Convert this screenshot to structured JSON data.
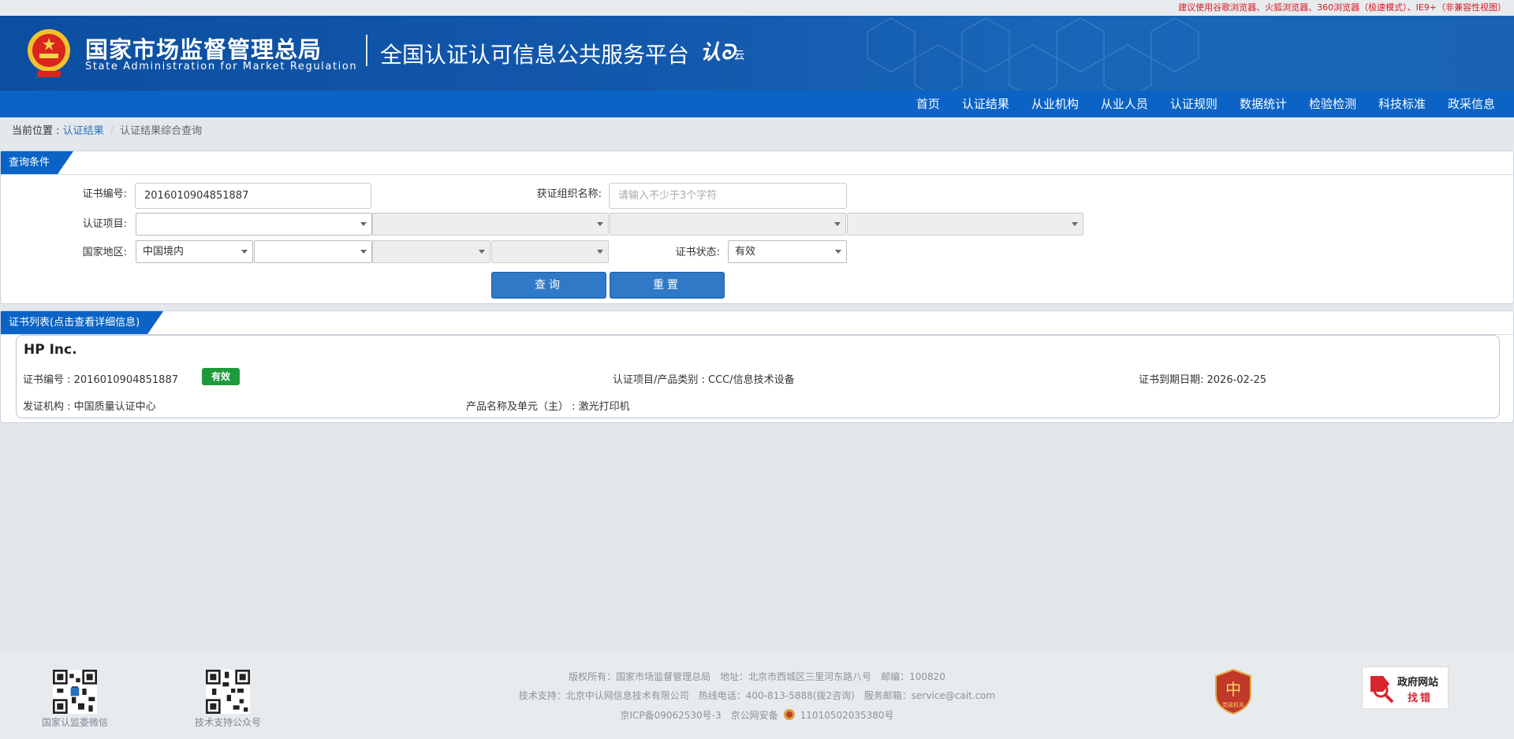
{
  "notice": "建议使用谷歌浏览器、火狐浏览器、360浏览器（极速模式）、IE9+（非兼容性视图）",
  "header": {
    "brand_cn": "国家市场监督管理总局",
    "brand_en": "State Administration  for  Market Regulation",
    "platform": "全国认证认可信息公共服务平台",
    "logo_text": "认",
    "logo_small": "云"
  },
  "nav": [
    "首页",
    "认证结果",
    "从业机构",
    "从业人员",
    "认证规则",
    "数据统计",
    "检验检测",
    "科技标准",
    "政采信息"
  ],
  "breadcrumb": {
    "prefix": "当前位置 : ",
    "link": "认证结果",
    "current": "认证结果综合查询"
  },
  "query": {
    "title": "查询条件",
    "cert_no_label": "证书编号:",
    "cert_no_value": "2016010904851887",
    "org_label": "获证组织名称:",
    "org_placeholder": "请输入不少于3个字符",
    "project_label": "认证项目:",
    "region_label": "国家地区:",
    "region_value": "中国境内",
    "status_label": "证书状态:",
    "status_value": "有效",
    "search_btn": "查询",
    "reset_btn": "重置"
  },
  "list": {
    "title": "证书列表(点击查看详细信息)",
    "results": [
      {
        "org": "HP Inc.",
        "cert_no": "证书编号 : 2016010904851887",
        "status": "有效",
        "category": "认证项目/产品类别 : CCC/信息技术设备",
        "expiry": "证书到期日期: 2026-02-25",
        "issuer": "发证机构 : 中国质量认证中心",
        "product": "产品名称及单元（主） : 激光打印机"
      }
    ]
  },
  "footer": {
    "qr1_caption": "国家认监委微信",
    "qr2_caption": "技术支持公众号",
    "line1": [
      "版权所有：国家市场监督管理总局",
      "地址：北京市西城区三里河东路八号",
      "邮编：100820"
    ],
    "line2": [
      "技术支持：北京中认网信息技术有限公司",
      "热线电话：400-813-5888(拨2咨询)",
      "服务邮箱：service@cait.com"
    ],
    "line3_icp": "京ICP备09062530号-3",
    "line3_police": "京公网安备",
    "line3_police_no": "11010502035380号",
    "gov_t1": "政府网站",
    "gov_t2": "找错",
    "party_text": "党政机关"
  }
}
